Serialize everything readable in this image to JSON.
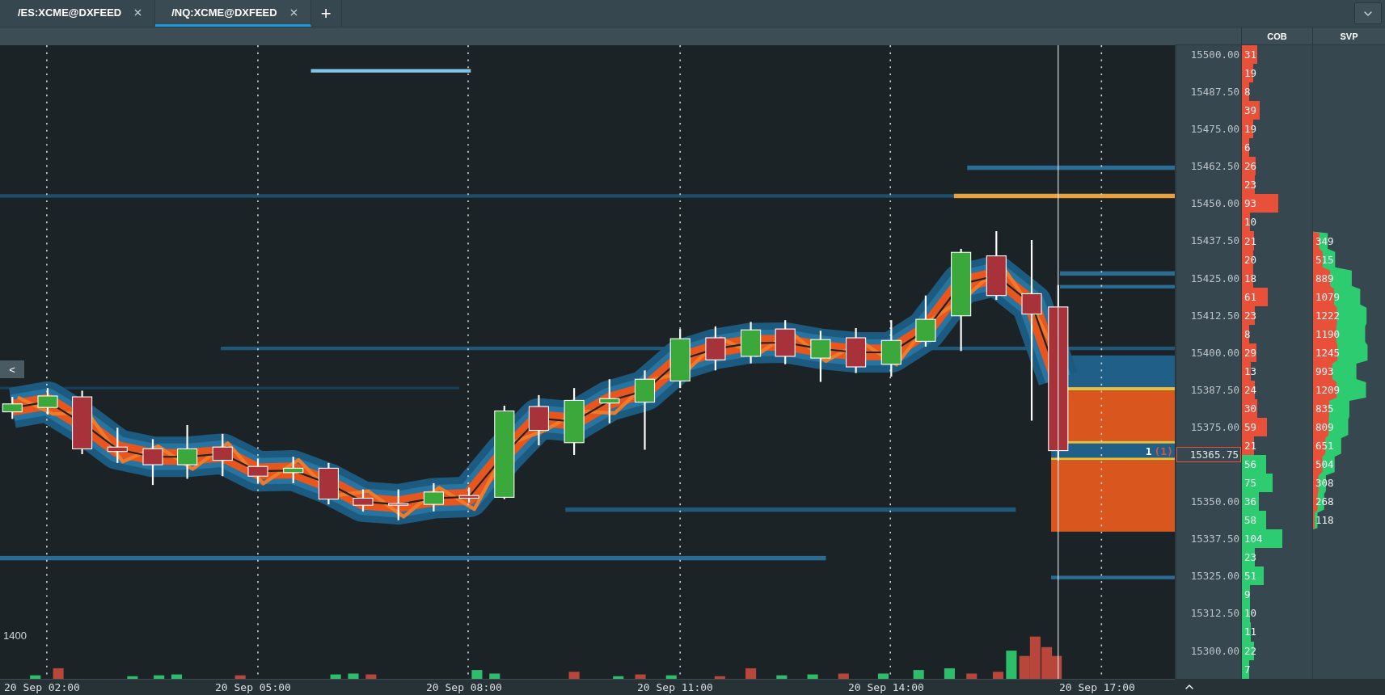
{
  "tabs": [
    {
      "label": "/ES:XCME@DXFEED",
      "selected": false
    },
    {
      "label": "/NQ:XCME@DXFEED",
      "selected": true
    }
  ],
  "add_tab": "+",
  "columns": [
    "COB",
    "SVP"
  ],
  "volume_scale": "1400",
  "collapse_button": "<",
  "time_labels": [
    "20 Sep 02:00",
    "20 Sep 05:00",
    "20 Sep 08:00",
    "20 Sep 11:00",
    "20 Sep 14:00",
    "20 Sep 17:00"
  ],
  "current_price": {
    "price": "15365.75",
    "order_size": "1",
    "order_count": "(1)"
  },
  "price_rows": [
    {
      "price": "15500.00",
      "cob": "31",
      "color": "#e8503a"
    },
    {
      "cob": "19",
      "color": "#e8503a"
    },
    {
      "price": "15487.50",
      "cob": "8",
      "color": "#e8503a"
    },
    {
      "cob": "39",
      "color": "#e8503a"
    },
    {
      "price": "15475.00",
      "cob": "19",
      "color": "#e8503a"
    },
    {
      "cob": "6",
      "color": "#e8503a"
    },
    {
      "price": "15462.50",
      "cob": "26",
      "color": "#e8503a"
    },
    {
      "cob": "23",
      "color": "#e8503a"
    },
    {
      "price": "15450.00",
      "cob": "93",
      "color": "#e8503a"
    },
    {
      "cob": "10",
      "color": "#e8503a"
    },
    {
      "price": "15437.50",
      "cob": "21",
      "color": "#e8503a",
      "svp": "349"
    },
    {
      "cob": "20",
      "color": "#e8503a",
      "svp": "515"
    },
    {
      "price": "15425.00",
      "cob": "18",
      "color": "#e8503a",
      "svp": "889"
    },
    {
      "cob": "61",
      "color": "#e8503a",
      "svp": "1079"
    },
    {
      "price": "15412.50",
      "cob": "23",
      "color": "#e8503a",
      "svp": "1222"
    },
    {
      "cob": "8",
      "color": "#e8503a",
      "svp": "1190"
    },
    {
      "price": "15400.00",
      "cob": "29",
      "color": "#e8503a",
      "svp": "1245"
    },
    {
      "cob": "13",
      "color": "#e8503a",
      "svp": "993"
    },
    {
      "price": "15387.50",
      "cob": "24",
      "color": "#e8503a",
      "svp": "1209"
    },
    {
      "cob": "30",
      "color": "#e8503a",
      "svp": "835"
    },
    {
      "price": "15375.00",
      "cob": "59",
      "color": "#e8503a",
      "svp": "809"
    },
    {
      "cob": "21",
      "color": "#e8503a",
      "svp": "651"
    },
    {
      "cob": "56",
      "color": "#2ecc71",
      "svp": "504"
    },
    {
      "cob": "75",
      "color": "#2ecc71",
      "svp": "308"
    },
    {
      "price": "15350.00",
      "cob": "36",
      "color": "#2ecc71",
      "svp": "268"
    },
    {
      "cob": "58",
      "color": "#2ecc71",
      "svp": "118"
    },
    {
      "price": "15337.50",
      "cob": "104",
      "color": "#2ecc71"
    },
    {
      "cob": "23",
      "color": "#2ecc71"
    },
    {
      "price": "15325.00",
      "cob": "51",
      "color": "#2ecc71"
    },
    {
      "cob": "9",
      "color": "#2ecc71"
    },
    {
      "price": "15312.50",
      "cob": "10",
      "color": "#2ecc71"
    },
    {
      "cob": "11",
      "color": "#2ecc71"
    },
    {
      "price": "15300.00",
      "cob": "22",
      "color": "#2ecc71"
    },
    {
      "cob": "7",
      "color": "#2ecc71"
    }
  ]
}
